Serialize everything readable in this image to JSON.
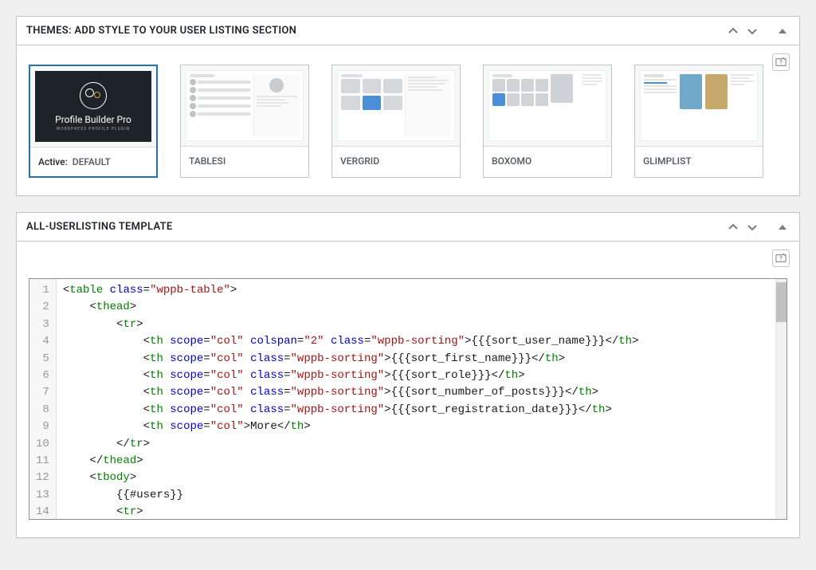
{
  "panels": {
    "themes": {
      "title": "THEMES: ADD STYLE TO YOUR USER LISTING SECTION"
    },
    "template": {
      "title": "ALL-USERLISTING TEMPLATE"
    }
  },
  "themes": [
    {
      "label": "DEFAULT",
      "active": true,
      "active_prefix": "Active:",
      "brand_title": "Profile Builder Pro",
      "brand_sub": "WORDPRESS PROFILE PLUGIN"
    },
    {
      "label": "TABLESI"
    },
    {
      "label": "VERGRID"
    },
    {
      "label": "BOXOMO"
    },
    {
      "label": "GLIMPLIST"
    }
  ],
  "code": {
    "lines": [
      [
        {
          "t": "bracket",
          "v": "<"
        },
        {
          "t": "tag",
          "v": "table"
        },
        {
          "t": "text",
          "v": " "
        },
        {
          "t": "attr",
          "v": "class"
        },
        {
          "t": "bracket",
          "v": "="
        },
        {
          "t": "string",
          "v": "\"wppb-table\""
        },
        {
          "t": "bracket",
          "v": ">"
        }
      ],
      [
        {
          "t": "indent",
          "v": "    "
        },
        {
          "t": "bracket",
          "v": "<"
        },
        {
          "t": "tag",
          "v": "thead"
        },
        {
          "t": "bracket",
          "v": ">"
        }
      ],
      [
        {
          "t": "indent",
          "v": "        "
        },
        {
          "t": "bracket",
          "v": "<"
        },
        {
          "t": "tag",
          "v": "tr"
        },
        {
          "t": "bracket",
          "v": ">"
        }
      ],
      [
        {
          "t": "indent",
          "v": "            "
        },
        {
          "t": "bracket",
          "v": "<"
        },
        {
          "t": "tag",
          "v": "th"
        },
        {
          "t": "text",
          "v": " "
        },
        {
          "t": "attr",
          "v": "scope"
        },
        {
          "t": "bracket",
          "v": "="
        },
        {
          "t": "string",
          "v": "\"col\""
        },
        {
          "t": "text",
          "v": " "
        },
        {
          "t": "attr",
          "v": "colspan"
        },
        {
          "t": "bracket",
          "v": "="
        },
        {
          "t": "string",
          "v": "\"2\""
        },
        {
          "t": "text",
          "v": " "
        },
        {
          "t": "attr",
          "v": "class"
        },
        {
          "t": "bracket",
          "v": "="
        },
        {
          "t": "string",
          "v": "\"wppb-sorting\""
        },
        {
          "t": "bracket",
          "v": ">"
        },
        {
          "t": "mustache",
          "v": "{{{sort_user_name}}}"
        },
        {
          "t": "bracket",
          "v": "</"
        },
        {
          "t": "tag",
          "v": "th"
        },
        {
          "t": "bracket",
          "v": ">"
        }
      ],
      [
        {
          "t": "indent",
          "v": "            "
        },
        {
          "t": "bracket",
          "v": "<"
        },
        {
          "t": "tag",
          "v": "th"
        },
        {
          "t": "text",
          "v": " "
        },
        {
          "t": "attr",
          "v": "scope"
        },
        {
          "t": "bracket",
          "v": "="
        },
        {
          "t": "string",
          "v": "\"col\""
        },
        {
          "t": "text",
          "v": " "
        },
        {
          "t": "attr",
          "v": "class"
        },
        {
          "t": "bracket",
          "v": "="
        },
        {
          "t": "string",
          "v": "\"wppb-sorting\""
        },
        {
          "t": "bracket",
          "v": ">"
        },
        {
          "t": "mustache",
          "v": "{{{sort_first_name}}}"
        },
        {
          "t": "bracket",
          "v": "</"
        },
        {
          "t": "tag",
          "v": "th"
        },
        {
          "t": "bracket",
          "v": ">"
        }
      ],
      [
        {
          "t": "indent",
          "v": "            "
        },
        {
          "t": "bracket",
          "v": "<"
        },
        {
          "t": "tag",
          "v": "th"
        },
        {
          "t": "text",
          "v": " "
        },
        {
          "t": "attr",
          "v": "scope"
        },
        {
          "t": "bracket",
          "v": "="
        },
        {
          "t": "string",
          "v": "\"col\""
        },
        {
          "t": "text",
          "v": " "
        },
        {
          "t": "attr",
          "v": "class"
        },
        {
          "t": "bracket",
          "v": "="
        },
        {
          "t": "string",
          "v": "\"wppb-sorting\""
        },
        {
          "t": "bracket",
          "v": ">"
        },
        {
          "t": "mustache",
          "v": "{{{sort_role}}}"
        },
        {
          "t": "bracket",
          "v": "</"
        },
        {
          "t": "tag",
          "v": "th"
        },
        {
          "t": "bracket",
          "v": ">"
        }
      ],
      [
        {
          "t": "indent",
          "v": "            "
        },
        {
          "t": "bracket",
          "v": "<"
        },
        {
          "t": "tag",
          "v": "th"
        },
        {
          "t": "text",
          "v": " "
        },
        {
          "t": "attr",
          "v": "scope"
        },
        {
          "t": "bracket",
          "v": "="
        },
        {
          "t": "string",
          "v": "\"col\""
        },
        {
          "t": "text",
          "v": " "
        },
        {
          "t": "attr",
          "v": "class"
        },
        {
          "t": "bracket",
          "v": "="
        },
        {
          "t": "string",
          "v": "\"wppb-sorting\""
        },
        {
          "t": "bracket",
          "v": ">"
        },
        {
          "t": "mustache",
          "v": "{{{sort_number_of_posts}}}"
        },
        {
          "t": "bracket",
          "v": "</"
        },
        {
          "t": "tag",
          "v": "th"
        },
        {
          "t": "bracket",
          "v": ">"
        }
      ],
      [
        {
          "t": "indent",
          "v": "            "
        },
        {
          "t": "bracket",
          "v": "<"
        },
        {
          "t": "tag",
          "v": "th"
        },
        {
          "t": "text",
          "v": " "
        },
        {
          "t": "attr",
          "v": "scope"
        },
        {
          "t": "bracket",
          "v": "="
        },
        {
          "t": "string",
          "v": "\"col\""
        },
        {
          "t": "text",
          "v": " "
        },
        {
          "t": "attr",
          "v": "class"
        },
        {
          "t": "bracket",
          "v": "="
        },
        {
          "t": "string",
          "v": "\"wppb-sorting\""
        },
        {
          "t": "bracket",
          "v": ">"
        },
        {
          "t": "mustache",
          "v": "{{{sort_registration_date}}}"
        },
        {
          "t": "bracket",
          "v": "</"
        },
        {
          "t": "tag",
          "v": "th"
        },
        {
          "t": "bracket",
          "v": ">"
        }
      ],
      [
        {
          "t": "indent",
          "v": "            "
        },
        {
          "t": "bracket",
          "v": "<"
        },
        {
          "t": "tag",
          "v": "th"
        },
        {
          "t": "text",
          "v": " "
        },
        {
          "t": "attr",
          "v": "scope"
        },
        {
          "t": "bracket",
          "v": "="
        },
        {
          "t": "string",
          "v": "\"col\""
        },
        {
          "t": "bracket",
          "v": ">"
        },
        {
          "t": "text",
          "v": "More"
        },
        {
          "t": "bracket",
          "v": "</"
        },
        {
          "t": "tag",
          "v": "th"
        },
        {
          "t": "bracket",
          "v": ">"
        }
      ],
      [
        {
          "t": "indent",
          "v": "        "
        },
        {
          "t": "bracket",
          "v": "</"
        },
        {
          "t": "tag",
          "v": "tr"
        },
        {
          "t": "bracket",
          "v": ">"
        }
      ],
      [
        {
          "t": "indent",
          "v": "    "
        },
        {
          "t": "bracket",
          "v": "</"
        },
        {
          "t": "tag",
          "v": "thead"
        },
        {
          "t": "bracket",
          "v": ">"
        }
      ],
      [
        {
          "t": "indent",
          "v": "    "
        },
        {
          "t": "bracket",
          "v": "<"
        },
        {
          "t": "tag",
          "v": "tbody"
        },
        {
          "t": "bracket",
          "v": ">"
        }
      ],
      [
        {
          "t": "indent",
          "v": "        "
        },
        {
          "t": "mustache",
          "v": "{{#users}}"
        }
      ],
      [
        {
          "t": "indent",
          "v": "        "
        },
        {
          "t": "bracket",
          "v": "<"
        },
        {
          "t": "tag",
          "v": "tr"
        },
        {
          "t": "bracket",
          "v": ">"
        }
      ]
    ]
  }
}
